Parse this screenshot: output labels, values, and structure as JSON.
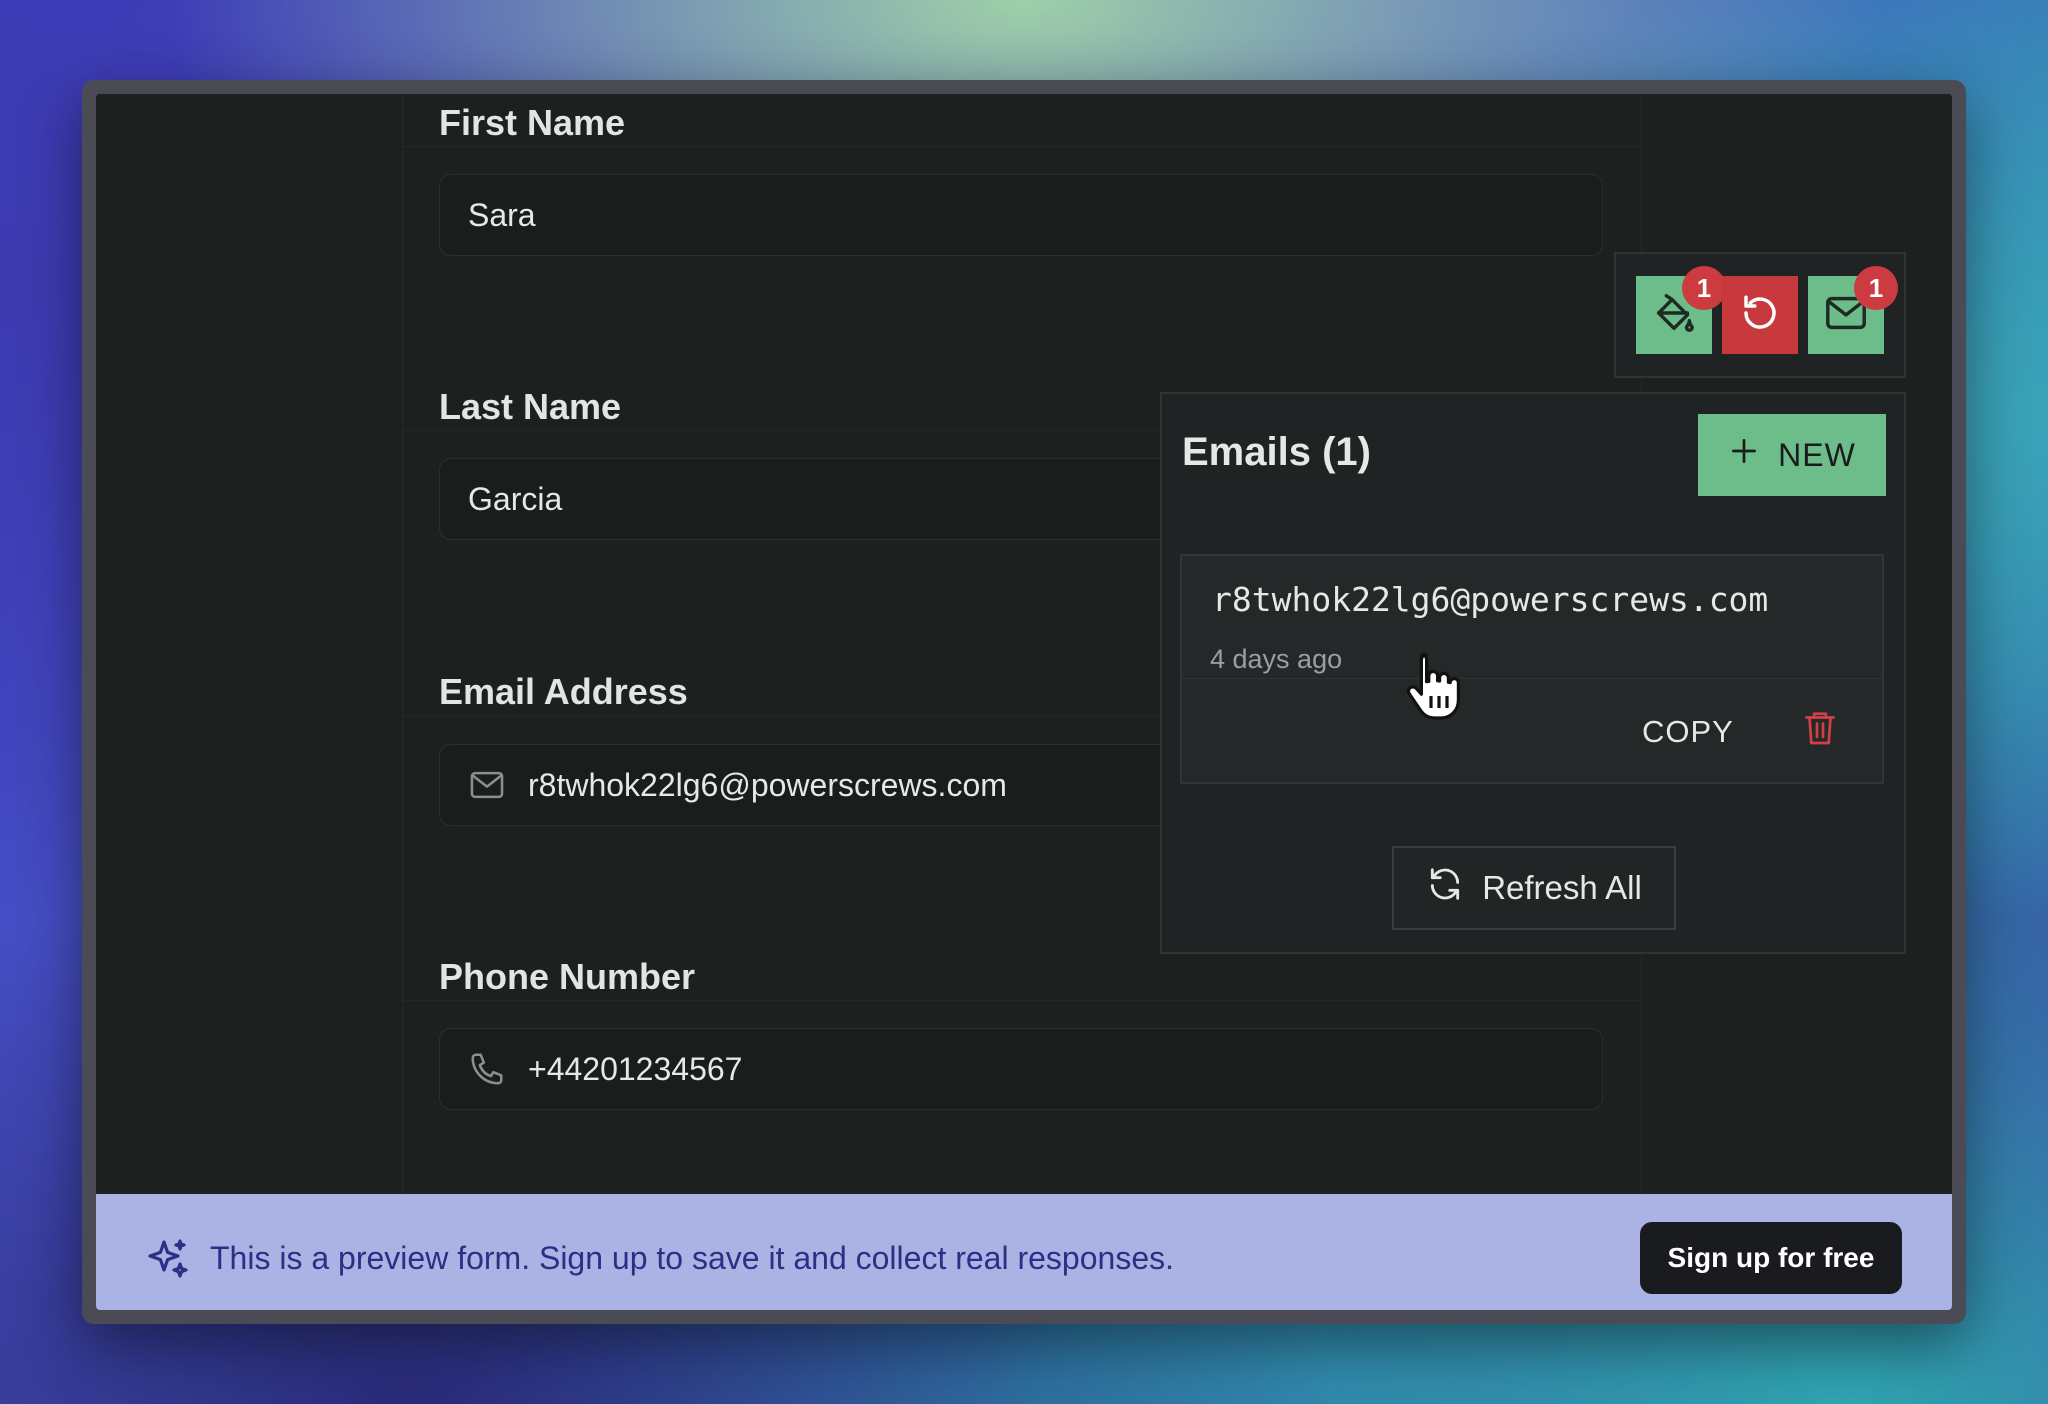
{
  "form": {
    "fields": [
      {
        "label": "First Name",
        "value": "Sara"
      },
      {
        "label": "Last Name",
        "value": "Garcia"
      },
      {
        "label": "Email Address",
        "value": "r8twhok22lg6@powerscrews.com"
      },
      {
        "label": "Phone Number",
        "value": "+44201234567"
      }
    ]
  },
  "toolbar": {
    "fill_badge": "1",
    "email_badge": "1",
    "icons": [
      "paint-bucket-icon",
      "reset-icon",
      "mail-icon"
    ]
  },
  "emails_panel": {
    "title": "Emails (1)",
    "new_label": "NEW",
    "items": [
      {
        "address": "r8twhok22lg6@powerscrews.com",
        "age": "4 days ago"
      }
    ],
    "copy_label": "COPY",
    "refresh_label": "Refresh All"
  },
  "banner": {
    "text": "This is a preview form. Sign up to save it and collect real responses.",
    "signup_label": "Sign up for free"
  },
  "colors": {
    "accent_green": "#6cbd8a",
    "danger_red": "#c8393d",
    "banner_bg": "#abb3e4",
    "banner_text": "#2b2f86"
  }
}
